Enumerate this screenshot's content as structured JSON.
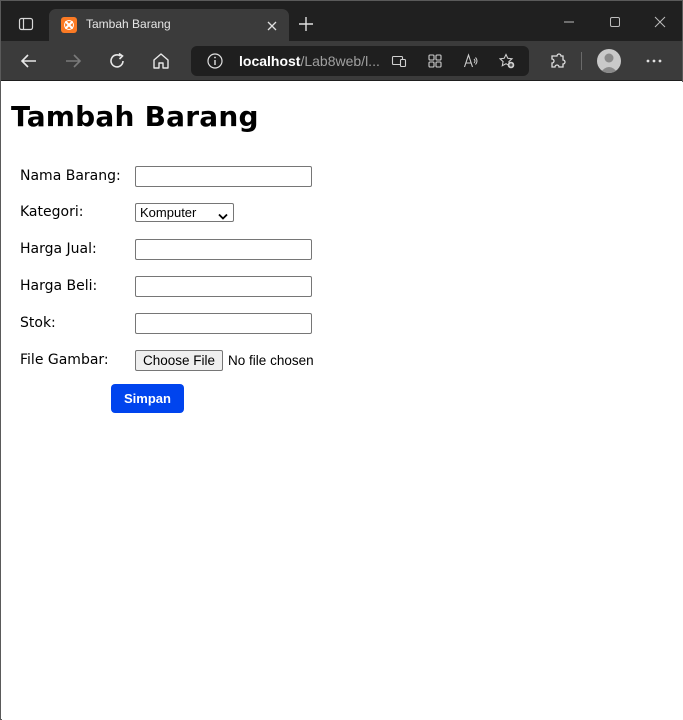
{
  "browser": {
    "tab_title": "Tambah Barang",
    "url_host": "localhost",
    "url_path": "/Lab8web/l...",
    "icons": [
      "tab-actions-icon",
      "xampp-favicon-icon",
      "close-icon",
      "plus-icon",
      "minimize-icon",
      "maximize-icon",
      "window-close-icon",
      "back-arrow-icon",
      "forward-arrow-icon",
      "refresh-icon",
      "home-icon",
      "info-icon",
      "app-available-icon",
      "apps-grid-icon",
      "read-aloud-icon",
      "add-favorite-icon",
      "extensions-icon",
      "profile-avatar-icon",
      "more-menu-icon"
    ],
    "theme": {
      "titlebar": "#202020",
      "toolbar": "#3b3b3b",
      "addressbar": "#1f1f1f",
      "favicon": "#fb7a24"
    }
  },
  "page": {
    "title": "Tambah Barang",
    "form": {
      "nama_label": "Nama Barang:",
      "nama_value": "",
      "kategori_label": "Kategori:",
      "kategori_selected": "Komputer",
      "harga_jual_label": "Harga Jual:",
      "harga_jual_value": "",
      "harga_beli_label": "Harga Beli:",
      "harga_beli_value": "",
      "stok_label": "Stok:",
      "stok_value": "",
      "file_label": "File Gambar:",
      "file_button": "Choose File",
      "file_status": "No file chosen",
      "submit_label": "Simpan"
    },
    "accent": "#0044ee"
  }
}
